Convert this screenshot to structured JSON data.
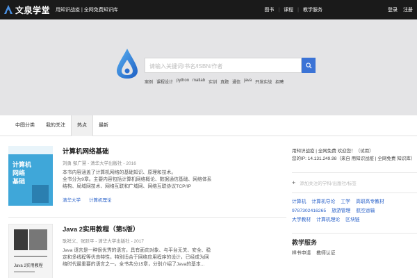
{
  "topbar": {
    "brand": "文泉学堂",
    "slogan": "用知识战疫 | 全网免费知识库",
    "nav": [
      "图书",
      "课程",
      "教学服务"
    ],
    "auth": [
      "登录",
      "注册"
    ]
  },
  "search": {
    "placeholder": "请输入关键词/书名/ISBN/作者",
    "hot_words": [
      "案例",
      "课程设计",
      "python",
      "matlab",
      "实训",
      "真题",
      "通信",
      "java",
      "开发实战",
      "招聘"
    ]
  },
  "tabs": [
    "中图分类",
    "我的关注",
    "热点",
    "最新"
  ],
  "active_tab": 2,
  "books": [
    {
      "title": "计算机网络基础",
      "meta": "刘勇 邹广慧 - 清华大学出版社 - 2016",
      "desc": [
        "本书内容涵盖了计算机网络的基础知识、原理和技术。",
        "全书分为9章。主要内容包括计算机网络概论、数据通信基础、网络体系",
        "结构、局域网技术、网络互联和广域网、网络互联协议TCP/IP"
      ],
      "tags": [
        "清华大学",
        "计算机理论"
      ],
      "cover_title": "计算机网络基础"
    },
    {
      "title": "Java 2实用教程（第5版）",
      "meta": "耿祥义、张跃平 - 清华大学出版社 - 2017",
      "desc": [
        "Java 语言是一种很优秀的语言，具有面向对象、与平台无关、安全、稳",
        "定和多线程等优良特性，特别适合于网络应用程序的设计，已经成为网",
        "络时代最重要的语言之一。全书共分15章，分别介绍了Java的基本..."
      ],
      "tags": [],
      "cover_title": "Java 2实用教程"
    }
  ],
  "sidebar": {
    "info_lines": [
      "用知识战疫 | 全网免费 欢迎您！（试用）",
      "您的IP: 14.131.249.98（来自 用知识战疫 | 全网免费 知识库）"
    ],
    "follow_placeholder": "添加关注的学科/出版社/标签",
    "tags": [
      [
        "计算机",
        "计算机导论",
        "工学",
        "高职高专教材"
      ],
      [
        "9787302416265",
        "旅游管理",
        "航空运输"
      ],
      [
        "大学教材",
        "计算机理论",
        "区块链"
      ]
    ],
    "service_heading": "教学服务",
    "service_links": [
      "样书申请",
      "教师认证"
    ]
  },
  "colors": {
    "accent": "#3b73d6",
    "topbar": "#1a1a1a",
    "hero": "#e4e4e6"
  }
}
